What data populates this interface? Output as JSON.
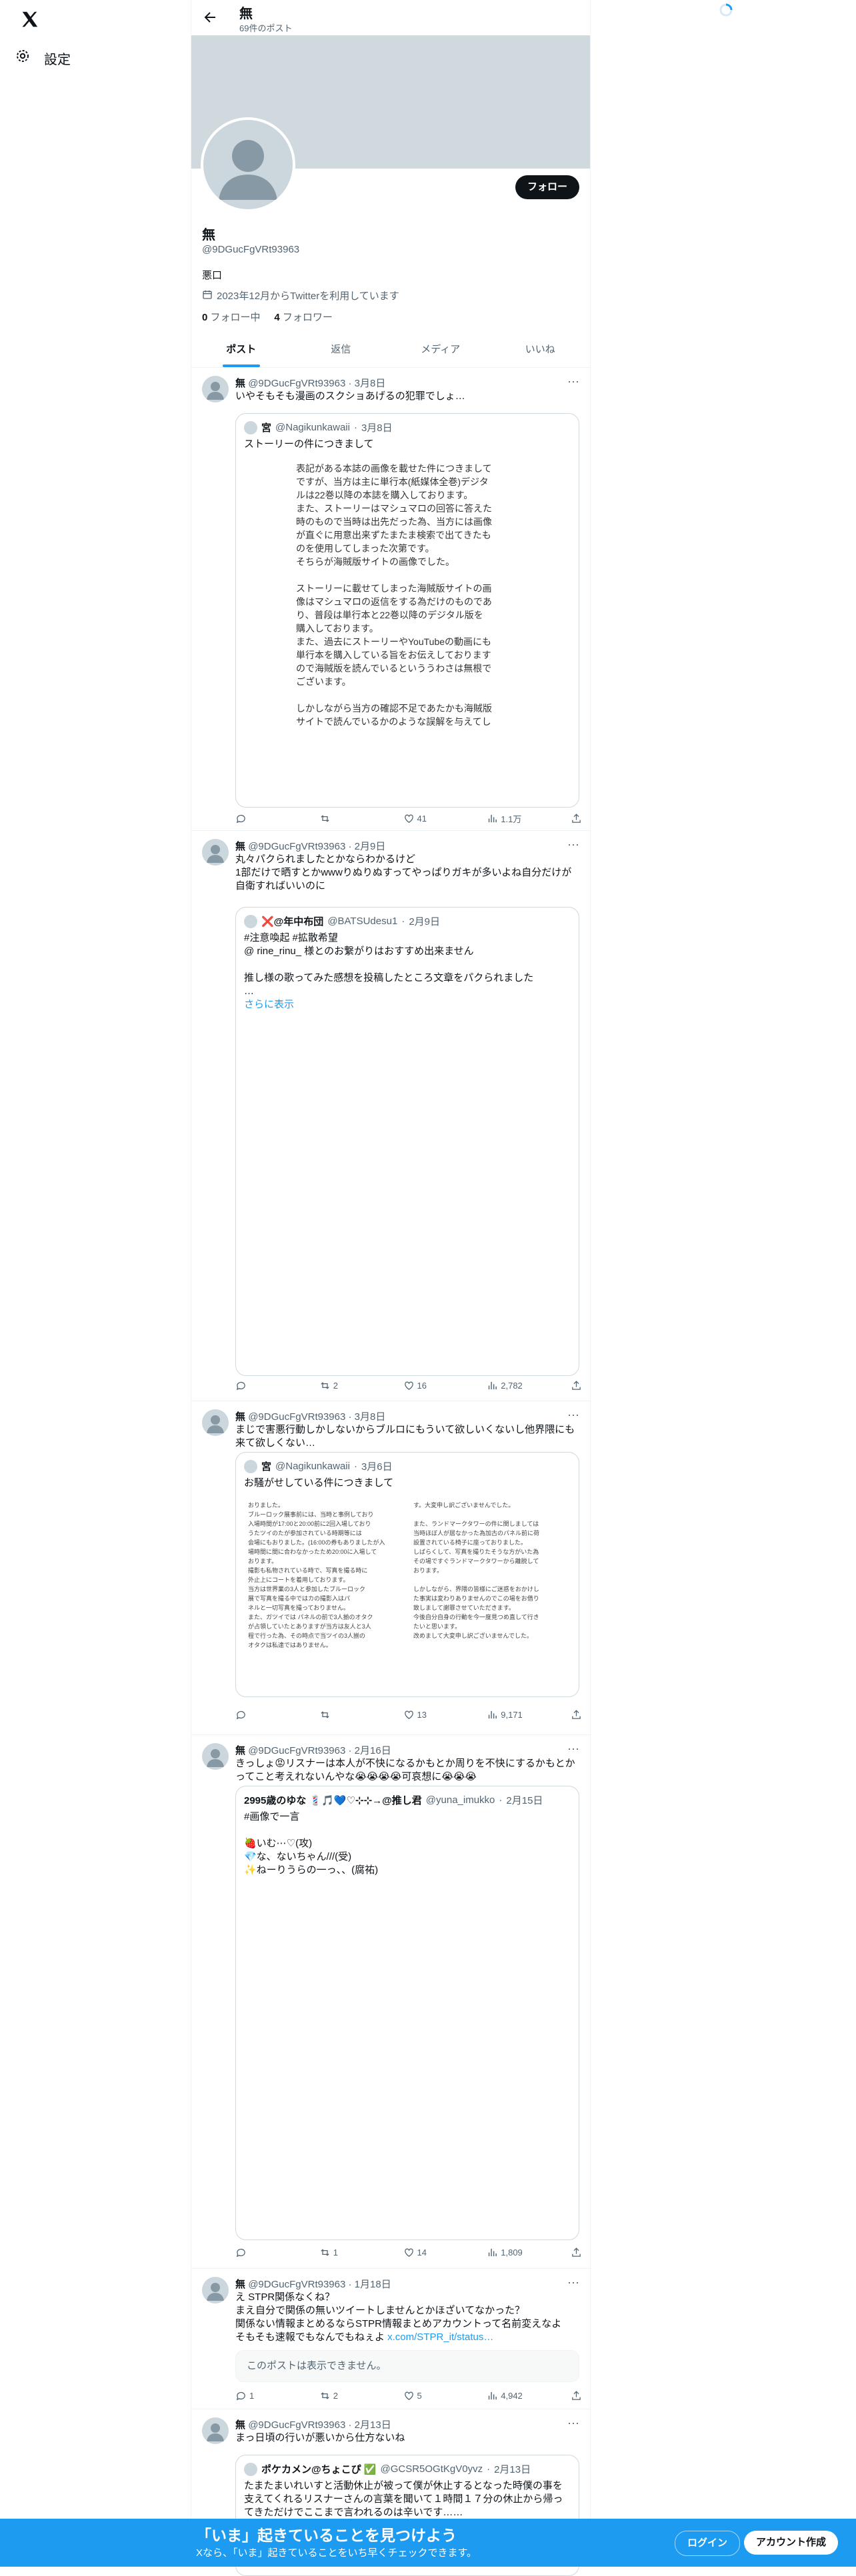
{
  "nav": {
    "settings_label": "設定"
  },
  "header": {
    "title": "無",
    "post_count": "69件のポスト"
  },
  "profile": {
    "follow_label": "フォロー",
    "name": "無",
    "handle": "@9DGucFgVRt93963",
    "bio": "悪口",
    "joined": "2023年12月からTwitterを利用しています",
    "following_count": "0",
    "following_label": "フォロー中",
    "followers_count": "4",
    "followers_label": "フォロワー"
  },
  "tabs": [
    "ポスト",
    "返信",
    "メディア",
    "いいね"
  ],
  "tweets": [
    {
      "name": "無",
      "handle": "@9DGucFgVRt93963",
      "date": "3月8日",
      "text": "いやそもそも漫画のスクショあげるの犯罪でしょ…",
      "quote": {
        "name": "宮",
        "handle": "@Nagikunkawaii",
        "date": "3月8日",
        "text": "ストーリーの件につきまして",
        "image_text": "表記がある本誌の画像を載せた件につきまして\nですが、当方は主に単行本(紙媒体全巻)デジタ\nルは22巻以降の本誌を購入しております。\nまた、ストーリーはマシュマロの回答に答えた\n時のもので当時は出先だった為、当方には画像\nが直ぐに用意出来ずたまたま検索で出てきたも\nのを使用してしまった次第です。\nそちらが海賊版サイトの画像でした。\n\nストーリーに載せてしまった海賊版サイトの画\n像はマシュマロの返信をする為だけのものであ\nり、普段は単行本と22巻以降のデジタル版を\n購入しております。\nまた、過去にストーリーやYouTubeの動画にも\n単行本を購入している旨をお伝えしております\nので海賊版を読んでいるといううわさは無根で\nございます。\n\nしかしながら当方の確認不足であたかも海賊版\nサイトで読んでいるかのような誤解を与えてし"
      },
      "replies": "",
      "reposts": "",
      "likes": "41",
      "views": "1.1万"
    },
    {
      "name": "無",
      "handle": "@9DGucFgVRt93963",
      "date": "2月9日",
      "text": "丸々パクられましたとかならわかるけど\n1部だけで晒すとかwwwりぬりぬすってやっぱりガキが多いよね自分だけが自衛すればいいのに",
      "quote": {
        "name": "❌@年中布団",
        "handle": "@BATSUdesu1",
        "date": "2月9日",
        "text": "#注意喚起 #拡散希望\n@ rine_rinu_ 様とのお繋がりはおすすめ出来ません\n\n推し様の歌ってみた感想を投稿したところ文章をパクられました\n…",
        "show_more": "さらに表示"
      },
      "replies": "",
      "reposts": "2",
      "likes": "16",
      "views": "2,782"
    },
    {
      "name": "無",
      "handle": "@9DGucFgVRt93963",
      "date": "3月8日",
      "text": "まじで害悪行動しかしないからブルロにもういて欲しいくないし他界隈にも来て欲しくない…",
      "quote": {
        "name": "宮",
        "handle": "@Nagikunkawaii",
        "date": "3月6日",
        "text": "お騒がせしている件につきまして",
        "image_left": "おりました。\nブルーロック展事前には、当時と事例しており\n入場時間が17:00と20:00前に2回入場しており\nうたツイのたが参加されている時期等には\n会場にもおりました。(16:00の券もありましたが入\n場時間に間に合わなかったため20:00に入場して\nおります。\n撮影も私物されている時で、写真を撮る時に\n外止上にコートを着用しております。\n当方は世界業の3人と参加したブルーロック\n展で写真を撮る中ではカの撮影入はパ\nネルと一切写真を撮っておりません。\nまた、ガツイでは パネルの前で3人揃のオタク\nが占領していたとありますが当方は友人と3人\n程で行った為、その時点で当ツイの3人揃の\nオタクは私達ではありません。",
        "image_right": "す。大変申し訳ございませんでした。\n\nまた、ランドマークタワーの件に関しましては\n当時ほぼ人が居なかった為加古のパネル前に荷\n設置されている椅子に座っておりました。\nしばらくして、写真を撮りたそうな方がいた為\nその場ですぐランドマークタワーから離脱して\nおります。\n\nしかしながら、界隈の皆様にご迷惑をおかけし\nた事実は変わりありませんのでこの場をお借り\n致しまして謝罪させていただきます。\n今後自分自身の行動を今一度見つめ直して行き\nたいと思います。\n改めまして大変申し訳ございませんでした。"
      },
      "replies": "",
      "reposts": "",
      "likes": "13",
      "views": "9,171"
    },
    {
      "name": "無",
      "handle": "@9DGucFgVRt93963",
      "date": "2月16日",
      "text": "きっしょ😡リスナーは本人が不快になるかもとか周りを不快にするかもとかってこと考えれないんやな😭😭😭😭可哀想に😭😭😭",
      "quote": {
        "name": "2995歳のゆな 💈🎵💙♡⊹⊹→@推し君",
        "handle": "@yuna_imukko",
        "date": "2月15日",
        "text": "#画像で一言\n\n🍓いむ⋯♡(攻)\n💎な、ないちゃん///(受)\n✨ねーりうらの一っ、、(腐祐)"
      },
      "replies": "",
      "reposts": "1",
      "likes": "14",
      "views": "1,809"
    },
    {
      "name": "無",
      "handle": "@9DGucFgVRt93963",
      "date": "1月18日",
      "text": "え STPR関係なくね？\nまえ自分で関係の無いツイートしませんとかほざいてなかった？\n関係ない情報まとめるならSTPR情報まとめアカウントって名前変えなよ\nそもそも速報でもなんでもねぇよ",
      "link": "x.com/STPR_it/status…",
      "unavailable": "このポストは表示できません。",
      "replies": "1",
      "reposts": "2",
      "likes": "5",
      "views": "4,942"
    },
    {
      "name": "無",
      "handle": "@9DGucFgVRt93963",
      "date": "2月13日",
      "text": "まっ日頃の行いが悪いから仕方ないね",
      "quote": {
        "name": "ポケカメン@ちょこぴ ✅",
        "handle": "@GCSR5OGtKgV0yvz",
        "date": "2月13日",
        "text": "たまたまいれいすと活動休止が被って僕が休止するとなった時僕の事を支えてくれるリスナーさんの言葉を聞いて１時間１７分の休止から帰ってきただけでここまで言われるのは辛いです……"
      }
    }
  ],
  "bottom_bar": {
    "title": "「いま」起きていることを見つけよう",
    "subtitle": "Xなら、「いま」起きていることをいち早くチェックできます。",
    "login": "ログイン",
    "signup": "アカウント作成"
  }
}
